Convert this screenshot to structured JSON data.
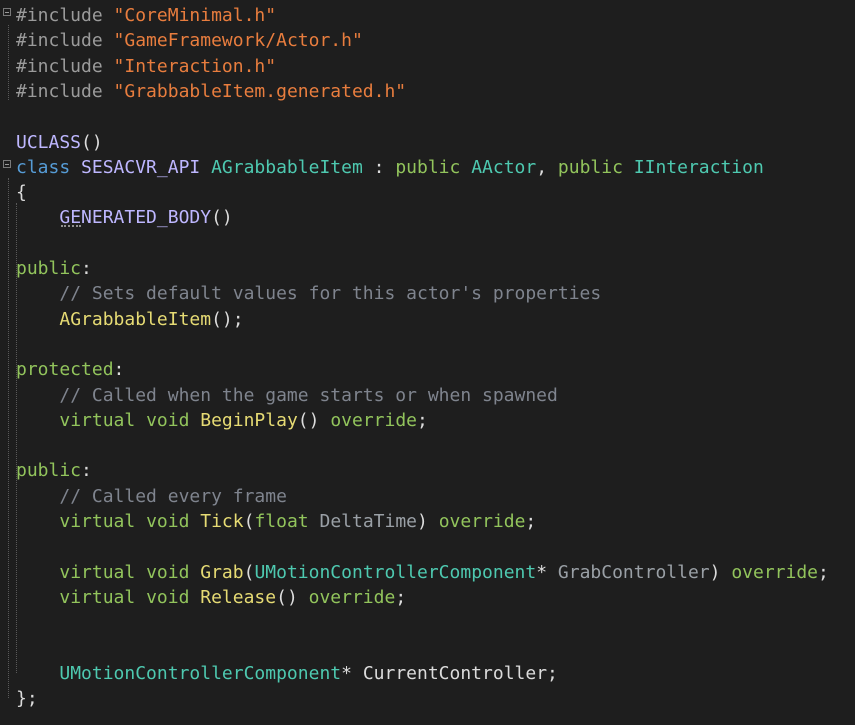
{
  "editor": {
    "language": "C++",
    "lines": [
      [
        {
          "t": "#include ",
          "c": "pp"
        },
        {
          "t": "\"CoreMinimal.h\"",
          "c": "str"
        }
      ],
      [
        {
          "t": "#include ",
          "c": "pp"
        },
        {
          "t": "\"GameFramework/Actor.h\"",
          "c": "str"
        }
      ],
      [
        {
          "t": "#include ",
          "c": "pp"
        },
        {
          "t": "\"Interaction.h\"",
          "c": "str"
        }
      ],
      [
        {
          "t": "#include ",
          "c": "pp"
        },
        {
          "t": "\"GrabbableItem.generated.h\"",
          "c": "str"
        }
      ],
      [],
      [
        {
          "t": "UCLASS",
          "c": "mac"
        },
        {
          "t": "()",
          "c": "punc"
        }
      ],
      [
        {
          "t": "class ",
          "c": "kw"
        },
        {
          "t": "SESACVR_API ",
          "c": "mac"
        },
        {
          "t": "AGrabbableItem ",
          "c": "type"
        },
        {
          "t": ": ",
          "c": "punc"
        },
        {
          "t": "public ",
          "c": "kwG"
        },
        {
          "t": "AActor",
          "c": "type"
        },
        {
          "t": ", ",
          "c": "punc"
        },
        {
          "t": "public ",
          "c": "kwG"
        },
        {
          "t": "IInteraction",
          "c": "type"
        }
      ],
      [
        {
          "t": "{",
          "c": "punc"
        }
      ],
      [
        {
          "t": "    ",
          "c": "punc"
        },
        {
          "t": "GENERATED_BODY",
          "c": "mac"
        },
        {
          "t": "()",
          "c": "punc"
        }
      ],
      [],
      [
        {
          "t": "public",
          "c": "kwG"
        },
        {
          "t": ":",
          "c": "punc"
        }
      ],
      [
        {
          "t": "    ",
          "c": "punc"
        },
        {
          "t": "// Sets default values for this actor's properties",
          "c": "com"
        }
      ],
      [
        {
          "t": "    ",
          "c": "punc"
        },
        {
          "t": "AGrabbableItem",
          "c": "fn"
        },
        {
          "t": "();",
          "c": "punc"
        }
      ],
      [],
      [
        {
          "t": "protected",
          "c": "kwG"
        },
        {
          "t": ":",
          "c": "punc"
        }
      ],
      [
        {
          "t": "    ",
          "c": "punc"
        },
        {
          "t": "// Called when the game starts or when spawned",
          "c": "com"
        }
      ],
      [
        {
          "t": "    ",
          "c": "punc"
        },
        {
          "t": "virtual ",
          "c": "kwG"
        },
        {
          "t": "void ",
          "c": "kwG"
        },
        {
          "t": "BeginPlay",
          "c": "fn"
        },
        {
          "t": "() ",
          "c": "punc"
        },
        {
          "t": "override",
          "c": "kwG"
        },
        {
          "t": ";",
          "c": "punc"
        }
      ],
      [],
      [
        {
          "t": "public",
          "c": "kwG"
        },
        {
          "t": ":",
          "c": "punc"
        }
      ],
      [
        {
          "t": "    ",
          "c": "punc"
        },
        {
          "t": "// Called every frame",
          "c": "com"
        }
      ],
      [
        {
          "t": "    ",
          "c": "punc"
        },
        {
          "t": "virtual ",
          "c": "kwG"
        },
        {
          "t": "void ",
          "c": "kwG"
        },
        {
          "t": "Tick",
          "c": "fn"
        },
        {
          "t": "(",
          "c": "punc"
        },
        {
          "t": "float ",
          "c": "kwG"
        },
        {
          "t": "DeltaTime",
          "c": "param"
        },
        {
          "t": ") ",
          "c": "punc"
        },
        {
          "t": "override",
          "c": "kwG"
        },
        {
          "t": ";",
          "c": "punc"
        }
      ],
      [],
      [
        {
          "t": "    ",
          "c": "punc"
        },
        {
          "t": "virtual ",
          "c": "kwG"
        },
        {
          "t": "void ",
          "c": "kwG"
        },
        {
          "t": "Grab",
          "c": "fn"
        },
        {
          "t": "(",
          "c": "punc"
        },
        {
          "t": "UMotionControllerComponent",
          "c": "type"
        },
        {
          "t": "* ",
          "c": "punc"
        },
        {
          "t": "GrabController",
          "c": "param"
        },
        {
          "t": ") ",
          "c": "punc"
        },
        {
          "t": "override",
          "c": "kwG"
        },
        {
          "t": ";",
          "c": "punc"
        }
      ],
      [
        {
          "t": "    ",
          "c": "punc"
        },
        {
          "t": "virtual ",
          "c": "kwG"
        },
        {
          "t": "void ",
          "c": "kwG"
        },
        {
          "t": "Release",
          "c": "fn"
        },
        {
          "t": "() ",
          "c": "punc"
        },
        {
          "t": "override",
          "c": "kwG"
        },
        {
          "t": ";",
          "c": "punc"
        }
      ],
      [],
      [],
      [
        {
          "t": "    ",
          "c": "punc"
        },
        {
          "t": "UMotionControllerComponent",
          "c": "type"
        },
        {
          "t": "* ",
          "c": "punc"
        },
        {
          "t": "CurrentController",
          "c": "ident"
        },
        {
          "t": ";",
          "c": "punc"
        }
      ],
      [
        {
          "t": "};",
          "c": "punc"
        }
      ]
    ]
  },
  "colors": {
    "background": "#1e1e1e",
    "string": "#e87d3e",
    "keyword": "#92c45c",
    "type": "#4ec9b0",
    "comment": "#7f848e",
    "function": "#e6db74",
    "macro": "#beb7ff"
  }
}
